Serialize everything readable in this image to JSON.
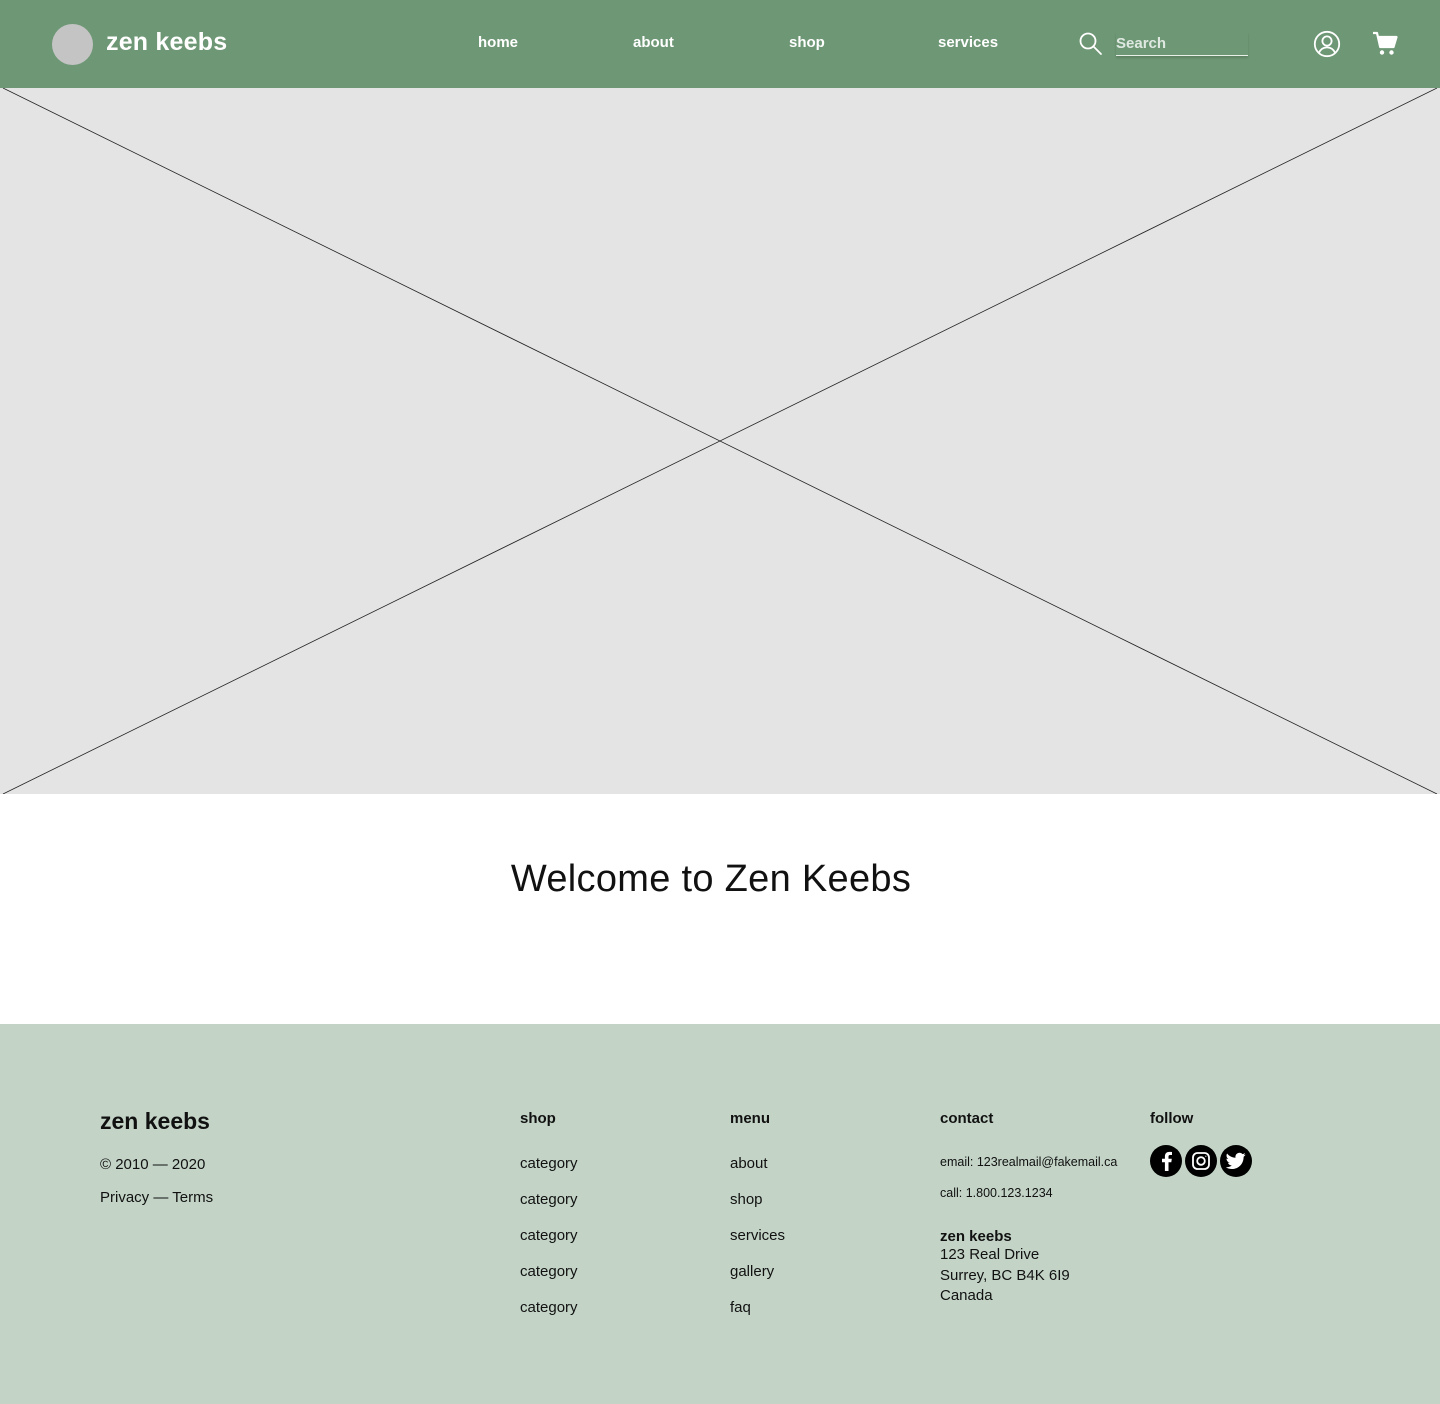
{
  "header": {
    "brand": "zen keebs",
    "nav": [
      {
        "label": "home"
      },
      {
        "label": "about"
      },
      {
        "label": "shop"
      },
      {
        "label": "services"
      }
    ],
    "search": {
      "placeholder": "Search",
      "value": ""
    },
    "icons": {
      "search": "search-icon",
      "account": "user-circle-icon",
      "cart": "shopping-cart-icon"
    }
  },
  "hero": {
    "type": "image-placeholder"
  },
  "main": {
    "welcome": "Welcome to Zen Keebs"
  },
  "footer": {
    "brand": "zen keebs",
    "copyright": "© 2010 — 2020",
    "legal": {
      "privacy": "Privacy",
      "separator": "—",
      "terms": "Terms"
    },
    "shop": {
      "heading": "shop",
      "links": [
        "category",
        "category",
        "category",
        "category",
        "category"
      ]
    },
    "menu": {
      "heading": "menu",
      "links": [
        "about",
        "shop",
        "services",
        "gallery",
        "faq"
      ]
    },
    "contact": {
      "heading": "contact",
      "email": "email: 123realmail@fakemail.ca",
      "phone": "call: 1.800.123.1234",
      "address": {
        "name": "zen keebs",
        "lines": [
          "123 Real Drive",
          "Surrey, BC B4K 6I9",
          "Canada"
        ]
      }
    },
    "follow": {
      "heading": "follow",
      "icons": [
        "facebook-icon",
        "instagram-icon",
        "twitter-icon"
      ]
    }
  },
  "colors": {
    "header_bg": "#6e9775",
    "footer_bg": "#c3d4c7",
    "hero_bg": "#e4e4e4",
    "logo_placeholder": "#c4c4c4"
  }
}
